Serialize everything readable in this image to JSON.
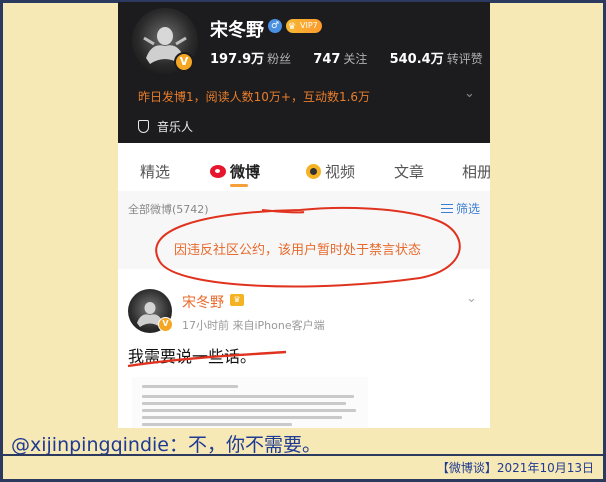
{
  "profile": {
    "name": "宋冬野",
    "gender_badge": "♂",
    "vip_label": "VIP7",
    "verify_badge": "V",
    "stats": [
      {
        "value": "197.9万",
        "label": "粉丝"
      },
      {
        "value": "747",
        "label": "关注"
      },
      {
        "value": "540.4万",
        "label": "转评赞"
      }
    ],
    "activity": "昨日发博1，阅读人数10万+，互动数1.6万",
    "verification": "音乐人"
  },
  "tabs": [
    {
      "label": "精选"
    },
    {
      "label": "微博"
    },
    {
      "label": "视频"
    },
    {
      "label": "文章"
    },
    {
      "label": "相册"
    }
  ],
  "feed": {
    "count_label": "全部微博(5742)",
    "filter_label": "筛选",
    "banned_notice": "因违反社区公约，该用户暂时处于禁言状态"
  },
  "post": {
    "author": "宋冬野",
    "meta": "17小时前  来自iPhone客户端",
    "text": "我需要说一些话。"
  },
  "caption": {
    "comment": "@xijinpingqindie：不，你不需要。",
    "source": "【微博谈】2021年10月13日"
  },
  "colors": {
    "background": "#f6e9b6",
    "caption_text": "#1f3a93",
    "annotation_red": "#e0331f",
    "accent_orange": "#e86a2c"
  }
}
